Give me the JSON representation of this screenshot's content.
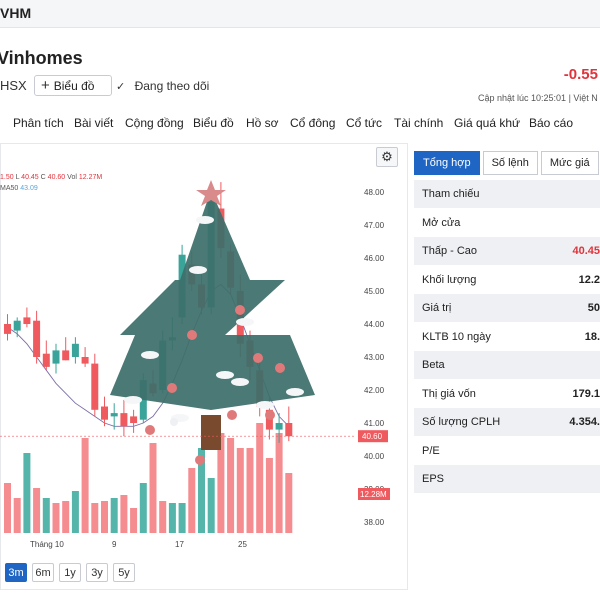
{
  "header": {
    "ticker": "VHM"
  },
  "company": {
    "name": "Vinhomes",
    "exchange": "HSX",
    "chart_button_label": "Biểu đồ",
    "follow_label": "Đang theo dõi",
    "price_change": "-0.55",
    "updated_text": "Cập nhật lúc  10:25:01 | Việt N"
  },
  "nav": [
    "Phân tích",
    "Bài viết",
    "Cộng đồng",
    "Biểu đồ",
    "Hồ sơ",
    "Cổ đông",
    "Cổ tức",
    "Tài chính",
    "Giá quá khứ",
    "Báo cáo"
  ],
  "chart": {
    "ohlc": {
      "open": "1.50",
      "low_label": "L",
      "low": "40.45",
      "close_label": "C",
      "close": "40.60",
      "vol_label": "Vol",
      "vol": "12.27M"
    },
    "ma_label": "MA50",
    "ma_value": "43.09",
    "current_price_tag": "40.60",
    "volume_tag": "12.28M",
    "colors": {
      "up": "#3aa39a",
      "down": "#ef5a5f",
      "vol_up": "#55b5ab",
      "vol_down": "#f48c90",
      "ma": "#7ab6e0"
    }
  },
  "range_tabs": [
    "3m",
    "6m",
    "1y",
    "3y",
    "5y"
  ],
  "active_range": "3m",
  "info_tabs": [
    "Tổng hợp",
    "Số lệnh",
    "Mức giá",
    "Th"
  ],
  "info": [
    {
      "label": "Tham chiếu",
      "value": ""
    },
    {
      "label": "Mở cửa",
      "value": ""
    },
    {
      "label": "Thấp - Cao",
      "value": "40.45"
    },
    {
      "label": "Khối lượng",
      "value": "12.2"
    },
    {
      "label": "Giá trị",
      "value": "50"
    },
    {
      "label": "KLTB 10 ngày",
      "value": "18."
    },
    {
      "label": "Beta",
      "value": ""
    },
    {
      "label": "Thị giá vốn",
      "value": "179.1"
    },
    {
      "label": "Số lượng CPLH",
      "value": "4.354."
    },
    {
      "label": "P/E",
      "value": ""
    },
    {
      "label": "EPS",
      "value": ""
    }
  ],
  "chart_data": {
    "type": "candlestick",
    "y_axis_ticks": [
      48.0,
      47.0,
      46.0,
      45.0,
      44.0,
      43.0,
      42.0,
      41.0,
      40.0,
      39.0,
      38.0
    ],
    "y_tick_labels": [
      "48.00",
      "47.00",
      "46.00",
      "45.00",
      "44.00",
      "43.00",
      "42.00",
      "41.00",
      "40.00",
      "39.00",
      "38.00"
    ],
    "ylim": [
      37.6,
      48.4
    ],
    "x_tick_labels": [
      "Tháng 10",
      "9",
      "17",
      "25"
    ],
    "ma50": [
      43.9,
      43.7,
      43.4,
      43.0,
      42.6,
      42.2,
      41.9,
      41.6,
      41.4,
      41.2,
      41.0,
      40.9,
      40.9,
      40.9,
      41.0,
      41.2,
      41.6,
      42.2,
      42.9,
      43.7,
      44.4,
      45.0,
      45.2,
      44.9,
      44.2,
      43.4,
      42.6,
      41.8,
      41.2,
      40.9
    ],
    "candles": [
      {
        "o": 44.0,
        "h": 44.3,
        "l": 43.5,
        "c": 43.7
      },
      {
        "o": 43.8,
        "h": 44.2,
        "l": 43.6,
        "c": 44.1
      },
      {
        "o": 44.2,
        "h": 44.5,
        "l": 43.9,
        "c": 44.0
      },
      {
        "o": 44.1,
        "h": 44.4,
        "l": 42.8,
        "c": 43.0
      },
      {
        "o": 43.1,
        "h": 43.5,
        "l": 42.6,
        "c": 42.7
      },
      {
        "o": 42.8,
        "h": 43.4,
        "l": 42.5,
        "c": 43.2
      },
      {
        "o": 43.2,
        "h": 43.6,
        "l": 42.9,
        "c": 42.9
      },
      {
        "o": 43.0,
        "h": 43.6,
        "l": 42.8,
        "c": 43.4
      },
      {
        "o": 43.0,
        "h": 43.3,
        "l": 42.7,
        "c": 42.8
      },
      {
        "o": 42.8,
        "h": 43.1,
        "l": 41.2,
        "c": 41.4
      },
      {
        "o": 41.5,
        "h": 41.8,
        "l": 40.9,
        "c": 41.1
      },
      {
        "o": 41.2,
        "h": 41.6,
        "l": 40.8,
        "c": 41.3
      },
      {
        "o": 41.3,
        "h": 41.7,
        "l": 40.6,
        "c": 40.9
      },
      {
        "o": 41.2,
        "h": 41.4,
        "l": 40.7,
        "c": 41.0
      },
      {
        "o": 41.1,
        "h": 42.5,
        "l": 41.0,
        "c": 42.3
      },
      {
        "o": 42.2,
        "h": 42.6,
        "l": 41.8,
        "c": 41.9
      },
      {
        "o": 42.0,
        "h": 43.8,
        "l": 41.9,
        "c": 43.5
      },
      {
        "o": 43.5,
        "h": 44.2,
        "l": 43.2,
        "c": 43.6
      },
      {
        "o": 44.2,
        "h": 46.4,
        "l": 44.0,
        "c": 46.1
      },
      {
        "o": 45.8,
        "h": 46.2,
        "l": 45.0,
        "c": 45.2
      },
      {
        "o": 45.2,
        "h": 45.6,
        "l": 44.3,
        "c": 44.5
      },
      {
        "o": 44.5,
        "h": 47.9,
        "l": 44.3,
        "c": 47.7
      },
      {
        "o": 47.5,
        "h": 48.3,
        "l": 46.0,
        "c": 46.3
      },
      {
        "o": 46.2,
        "h": 46.4,
        "l": 44.9,
        "c": 45.1
      },
      {
        "o": 45.0,
        "h": 45.5,
        "l": 43.0,
        "c": 43.4
      },
      {
        "o": 43.5,
        "h": 43.8,
        "l": 42.3,
        "c": 42.7
      },
      {
        "o": 42.6,
        "h": 43.0,
        "l": 41.2,
        "c": 41.5
      },
      {
        "o": 41.4,
        "h": 41.8,
        "l": 40.5,
        "c": 40.8
      },
      {
        "o": 40.8,
        "h": 41.3,
        "l": 40.4,
        "c": 41.0
      },
      {
        "o": 41.0,
        "h": 41.5,
        "l": 40.45,
        "c": 40.6
      }
    ],
    "volumes": [
      {
        "v": 0.5,
        "up": false
      },
      {
        "v": 0.35,
        "up": false
      },
      {
        "v": 0.8,
        "up": true
      },
      {
        "v": 0.45,
        "up": false
      },
      {
        "v": 0.35,
        "up": true
      },
      {
        "v": 0.3,
        "up": false
      },
      {
        "v": 0.32,
        "up": false
      },
      {
        "v": 0.42,
        "up": true
      },
      {
        "v": 0.95,
        "up": false
      },
      {
        "v": 0.3,
        "up": false
      },
      {
        "v": 0.32,
        "up": false
      },
      {
        "v": 0.35,
        "up": true
      },
      {
        "v": 0.38,
        "up": false
      },
      {
        "v": 0.25,
        "up": false
      },
      {
        "v": 0.5,
        "up": true
      },
      {
        "v": 0.9,
        "up": false
      },
      {
        "v": 0.32,
        "up": false
      },
      {
        "v": 0.3,
        "up": true
      },
      {
        "v": 0.3,
        "up": true
      },
      {
        "v": 0.65,
        "up": false
      },
      {
        "v": 0.85,
        "up": true
      },
      {
        "v": 0.55,
        "up": true
      },
      {
        "v": 1.0,
        "up": false
      },
      {
        "v": 0.95,
        "up": false
      },
      {
        "v": 0.85,
        "up": false
      },
      {
        "v": 0.85,
        "up": false
      },
      {
        "v": 1.1,
        "up": false
      },
      {
        "v": 0.75,
        "up": false
      },
      {
        "v": 1.0,
        "up": false
      },
      {
        "v": 0.6,
        "up": false
      }
    ]
  }
}
